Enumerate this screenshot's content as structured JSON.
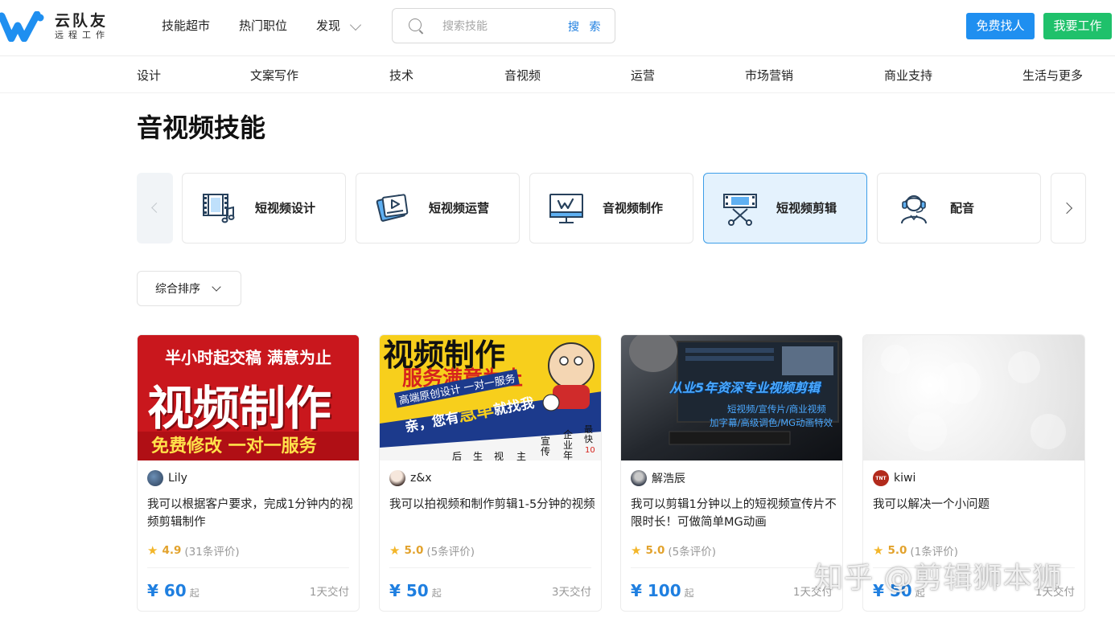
{
  "colors": {
    "brand_blue": "#1f8ff0",
    "brand_green": "#1fc16b",
    "price_blue": "#1f7fe0",
    "rating_orange": "#e2a22c",
    "active_card_bg": "#e4f2fd"
  },
  "header": {
    "logo_name": "云队友",
    "logo_sub": "远程工作",
    "nav": [
      "技能超市",
      "热门职位",
      "发现"
    ],
    "search_placeholder": "搜索技能",
    "search_button": "搜 索",
    "find_button": "免费找人",
    "work_button": "我要工作"
  },
  "categories": [
    "设计",
    "文案写作",
    "技术",
    "音视频",
    "运营",
    "市场营销",
    "商业支持",
    "生活与更多"
  ],
  "page_title": "音视频技能",
  "skills": [
    {
      "label": "短视频设计",
      "icon": "film-music-icon",
      "active": false
    },
    {
      "label": "短视频运营",
      "icon": "video-operation-icon",
      "active": false
    },
    {
      "label": "音视频制作",
      "icon": "monitor-video-icon",
      "active": false
    },
    {
      "label": "短视频剪辑",
      "icon": "film-scissors-icon",
      "active": true
    },
    {
      "label": "配音",
      "icon": "headset-person-icon",
      "active": false
    }
  ],
  "sort_label": "综合排序",
  "cards": [
    {
      "image_text": [
        "半小时起交稿 满意为止",
        "视频制作",
        "免费修改 一对一服务"
      ],
      "user": "Lily",
      "title": "我可以根据客户要求，完成1分钟内的视频剪辑制作",
      "rating": "4.9",
      "reviews": "(31条评价)",
      "price": "¥ 60",
      "price_suffix": "起",
      "delivery": "1天交付"
    },
    {
      "image_text": [
        "视频制作",
        "服务满意为止",
        "高端原创设计 一对一服务",
        "亲，您有",
        "急单",
        "就找我",
        "最快",
        "10",
        "企业年",
        "宣传",
        "主",
        "视",
        "生",
        "后"
      ],
      "user": "z&x",
      "title": "我可以拍视频和制作剪辑1-5分钟的视频",
      "rating": "5.0",
      "reviews": "(5条评价)",
      "price": "¥ 50",
      "price_suffix": "起",
      "delivery": "3天交付"
    },
    {
      "image_text": [
        "从业5年资深专业视频剪辑",
        "短视频/宣传片/商业视频",
        "加字幕/高级调色/MG动画特效"
      ],
      "user": "解浩辰",
      "title": "我可以剪辑1分钟以上的短视频宣传片不限时长！可做简单MG动画",
      "rating": "5.0",
      "reviews": "(5条评价)",
      "price": "¥ 100",
      "price_suffix": "起",
      "delivery": "1天交付"
    },
    {
      "image_text": [],
      "user": "kiwi",
      "avatar_text": "TNT",
      "title": "我可以解决一个小问题",
      "rating": "5.0",
      "reviews": "(1条评价)",
      "price": "¥ 50",
      "price_suffix": "起",
      "delivery": "1天交付"
    }
  ],
  "watermark": "知乎 @剪辑狮本狮"
}
